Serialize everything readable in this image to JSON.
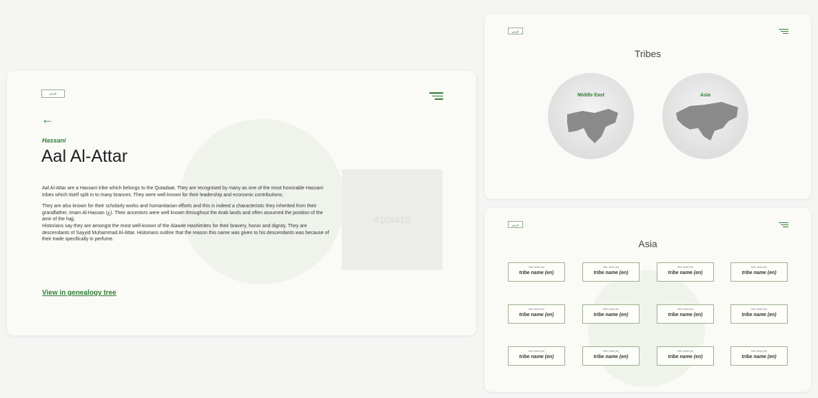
{
  "main_card": {
    "lang_label": "عربي",
    "subtitle": "Hassani",
    "title": "Aal Al-Attar",
    "paragraphs": [
      "Aal Al-Attar are a Hassani tribe which belongs to the Qutadaat. They are recognised by many as one of the most honorable Hassani tribes which itself split in to many brances. They were well known for their leadership and economic contributions.",
      "They are also known for their scholarly works and humanitarian efforts and this is indeed a characteristic they inherited from their grandfather, Imam Al-Hassan (ع). Their ancestors were well known throughout the Arab lands and often assumed the position of the amir of the hajj.",
      "Historians say they are amongst the most well-known of the Alawite Hashimites for their bravery, honor and dignity. They are descendants of Sayyid Muhammad Al-Attar. Historians outline that the reason this name was given to his descendants was because of their trade specifically in perfume."
    ],
    "image_placeholder": "410x410",
    "genealogy_link": "View in genealogy tree"
  },
  "tribes_card": {
    "lang_label": "عربي",
    "title": "Tribes",
    "regions": [
      {
        "label": "Middle East"
      },
      {
        "label": "Asia"
      }
    ]
  },
  "asia_card": {
    "lang_label": "عربي",
    "title": "Asia",
    "tribes": [
      {
        "ar": "tribe name (ar)",
        "en": "tribe name (en)"
      },
      {
        "ar": "tribe name (ar)",
        "en": "tribe name (en)"
      },
      {
        "ar": "tribe name (ar)",
        "en": "tribe name (en)"
      },
      {
        "ar": "tribe name (ar)",
        "en": "tribe name (en)"
      },
      {
        "ar": "tribe name (ar)",
        "en": "tribe name (en)"
      },
      {
        "ar": "tribe name (ar)",
        "en": "tribe name (en)"
      },
      {
        "ar": "tribe name (ar)",
        "en": "tribe name (en)"
      },
      {
        "ar": "tribe name (ar)",
        "en": "tribe name (en)"
      },
      {
        "ar": "tribe name (ar)",
        "en": "tribe name (en)"
      },
      {
        "ar": "tribe name (ar)",
        "en": "tribe name (en)"
      },
      {
        "ar": "tribe name (ar)",
        "en": "tribe name (en)"
      },
      {
        "ar": "tribe name (ar)",
        "en": "tribe name (en)"
      }
    ]
  },
  "colors": {
    "accent": "#2e7d32",
    "card_bg": "#fafaf7",
    "page_bg": "#f5f5f4"
  },
  "icons": {
    "menu": "hamburger-menu-icon",
    "back": "left-arrow-icon"
  }
}
